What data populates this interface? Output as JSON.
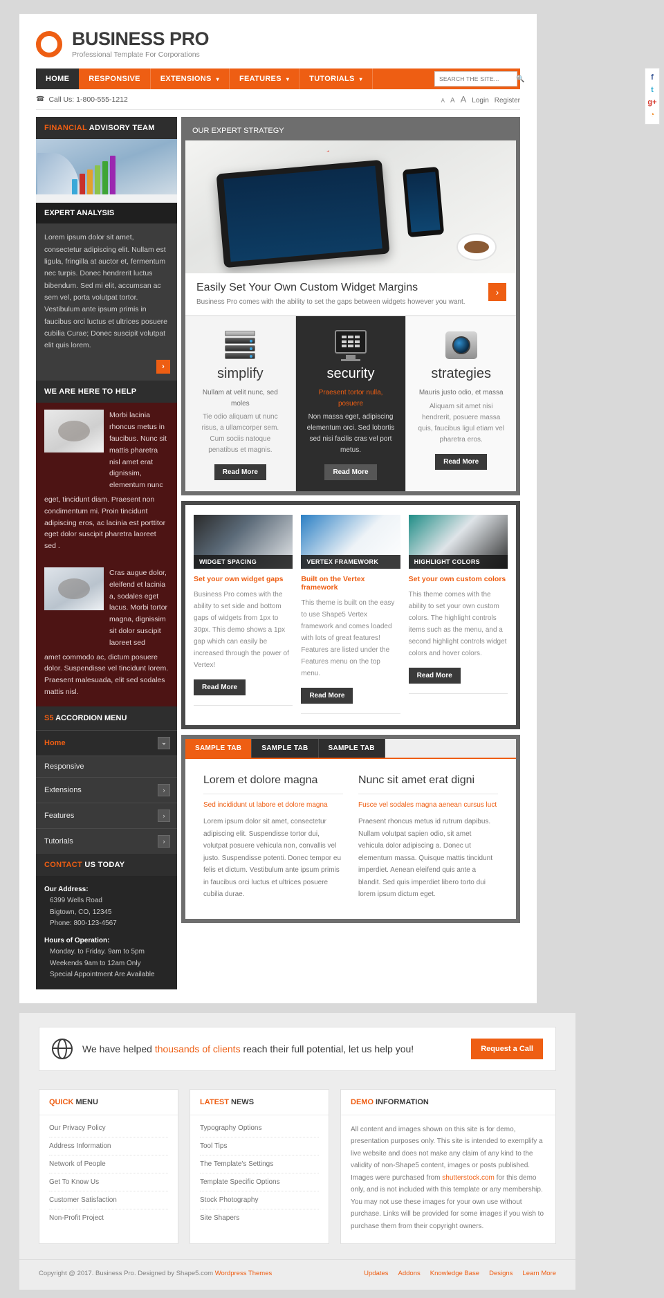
{
  "brand": {
    "name": "BUSINESS PRO",
    "tagline": "Professional Template For Corporations"
  },
  "nav": {
    "items": [
      {
        "label": "HOME",
        "caret": "",
        "active": true
      },
      {
        "label": "RESPONSIVE",
        "caret": "",
        "active": false
      },
      {
        "label": "EXTENSIONS",
        "caret": "▾",
        "active": false
      },
      {
        "label": "FEATURES",
        "caret": "▾",
        "active": false
      },
      {
        "label": "TUTORIALS",
        "caret": "▾",
        "active": false
      }
    ],
    "search_placeholder": "SEARCH THE SITE...",
    "search_value": "",
    "search_icon": "search-icon"
  },
  "utility": {
    "phone_icon": "phone-icon",
    "call_label": "Call Us: 1-800-555-1212",
    "font_small": "A",
    "font_medium": "A",
    "font_large": "A",
    "login": "Login",
    "register": "Register"
  },
  "social": {
    "facebook": "f",
    "twitter": "t",
    "googleplus": "g+",
    "rss": "◔"
  },
  "sidebar": {
    "financial": {
      "head_hl": "FINANCIAL",
      "head_rest": " ADVISORY TEAM",
      "subhead": "EXPERT ANALYSIS",
      "body": "Lorem ipsum dolor sit amet, consectetur adipiscing elit. Nullam est ligula, fringilla at auctor et, fermentum nec turpis. Donec hendrerit luctus bibendum. Sed mi elit, accumsan ac sem vel, porta volutpat tortor. Vestibulum ante ipsum primis in faucibus orci luctus et ultrices posuere cubilia Curae; Donec suscipit volutpat elit quis lorem.",
      "more_icon": "›"
    },
    "help": {
      "head": "WE ARE HERE TO HELP",
      "item1_text": "Morbi lacinia rhoncus metus in faucibus. Nunc sit mattis pharetra nisl amet erat dignissim, elementum nunc",
      "item1_tail": "eget, tincidunt diam. Praesent non condimentum mi. Proin tincidunt adipiscing eros, ac lacinia est porttitor eget dolor suscipit pharetra laoreet sed .",
      "item2_text": "Cras augue dolor, eleifend et lacinia a, sodales eget lacus. Morbi tortor magna, dignissim sit dolor suscipit laoreet sed",
      "item2_tail": "amet commodo ac, dictum posuere dolor. Suspendisse vel tincidunt lorem. Praesent malesuada, elit sed sodales mattis nisl."
    },
    "accordion": {
      "head_hl": "S5",
      "head_rest": " ACCORDION MENU",
      "items": [
        {
          "label": "Home",
          "active": true,
          "chevron": "⌄"
        },
        {
          "label": "Responsive",
          "active": false,
          "chevron": ""
        },
        {
          "label": "Extensions",
          "active": false,
          "chevron": "›"
        },
        {
          "label": "Features",
          "active": false,
          "chevron": "›"
        },
        {
          "label": "Tutorials",
          "active": false,
          "chevron": "›"
        }
      ]
    },
    "contact": {
      "head_hl": "CONTACT",
      "head_rest": " US TODAY",
      "address_label": "Our Address:",
      "address_line1": "6399 Wells Road",
      "address_line2": "Bigtown, CO, 12345",
      "address_line3": "Phone: 800-123-4567",
      "hours_label": "Hours of Operation:",
      "hours_line1": "Monday. to Friday. 9am to 5pm",
      "hours_line2": "Weekends 9am to 12am Only",
      "hours_line3": "Special Appointment Are Available"
    }
  },
  "main": {
    "strategy_head": "OUR EXPERT STRATEGY",
    "hero": {
      "title": "Easily Set Your Own Custom Widget Margins",
      "subtitle": "Business Pro comes with the ability to set the gaps between widgets however you want.",
      "next_icon": "›"
    },
    "features": [
      {
        "title": "simplify",
        "icon": "server-icon",
        "lead": "Nullam at velit nunc, sed moles",
        "desc": "Tie odio aliquam ut nunc risus, a ullamcorper sem. Cum sociis natoque penatibus et magnis.",
        "button": "Read More"
      },
      {
        "title": "security",
        "icon": "monitor-keypad-icon",
        "lead": "Praesent tortor nulla, posuere",
        "desc": "Non massa eget, adipiscing elementum orci. Sed lobortis sed nisi facilis cras vel port metus.",
        "button": "Read More"
      },
      {
        "title": "strategies",
        "icon": "camera-lens-icon",
        "lead": "Mauris justo odio, et massa",
        "desc": "Aliquam sit amet nisi hendrerit, posuere massa quis, faucibus ligul etiam vel pharetra eros.",
        "button": "Read More"
      }
    ],
    "cards": [
      {
        "image_label": "WIDGET SPACING",
        "title": "Set your own widget gaps",
        "body": "Business Pro comes with the ability to set side and bottom gaps of widgets from 1px to 30px. This demo shows a 1px gap which can easily be increased through the power of Vertex!",
        "button": "Read More"
      },
      {
        "image_label": "VERTEX FRAMEWORK",
        "title": "Built on the Vertex framework",
        "body": "This theme is built on the easy to use Shape5 Vertex framework and comes loaded with lots of great features! Features are listed under the Features menu on the top menu.",
        "button": "Read More"
      },
      {
        "image_label": "HIGHLIGHT COLORS",
        "title": "Set your own custom colors",
        "body": "This theme comes with the ability to set your own custom colors. The highlight controls items such as the menu, and a second highlight controls widget colors and hover colors.",
        "button": "Read More"
      }
    ],
    "tabs": {
      "items": [
        {
          "label": "SAMPLE TAB",
          "active": true
        },
        {
          "label": "SAMPLE TAB",
          "active": false
        },
        {
          "label": "SAMPLE TAB",
          "active": false
        }
      ],
      "columns": [
        {
          "title": "Lorem et dolore magna",
          "sub": "Sed incididunt ut labore et dolore magna",
          "body": "Lorem ipsum dolor sit amet, consectetur adipiscing elit. Suspendisse tortor dui, volutpat posuere vehicula non, convallis vel justo. Suspendisse potenti. Donec tempor eu felis et dictum. Vestibulum ante ipsum primis in faucibus orci luctus et ultrices posuere cubilia durae."
        },
        {
          "title": "Nunc sit amet erat digni",
          "sub": "Fusce vel sodales magna aenean cursus luct",
          "body": "Praesent rhoncus metus id rutrum dapibus. Nullam volutpat sapien odio, sit amet vehicula dolor adipiscing a. Donec ut elementum massa. Quisque mattis tincidunt imperdiet. Aenean eleifend quis ante a blandit. Sed quis imperdiet libero torto dui lorem ipsum dictum eget."
        }
      ]
    }
  },
  "cta": {
    "icon": "globe-icon",
    "text_before": "We have helped ",
    "text_highlight": "thousands of clients",
    "text_after": " reach their full potential, let us help you!",
    "button": "Request a Call"
  },
  "footer": {
    "quick": {
      "head_hl": "QUICK",
      "head_rest": " MENU",
      "items": [
        "Our Privacy Policy",
        "Address Information",
        "Network of People",
        "Get To Know Us",
        "Customer Satisfaction",
        "Non-Profit Project"
      ]
    },
    "latest": {
      "head_hl": "LATEST",
      "head_rest": " NEWS",
      "items": [
        "Typography Options",
        "Tool Tips",
        "The Template's Settings",
        "Template Specific Options",
        "Stock Photography",
        "Site Shapers"
      ]
    },
    "demo": {
      "head_hl": "DEMO",
      "head_rest": " INFORMATION",
      "text_before": "All content and images shown on this site is for demo, presentation purposes only. This site is intended to exemplify a live website and does not make any claim of any kind to the validity of non-Shape5 content, images or posts published. Images were purchased from ",
      "text_highlight": "shutterstock.com",
      "text_after": " for this demo only, and is not included with this template or any membership. You may not use these images for your own use without purchase. Links will be provided for some images if you wish to purchase them from their copyright owners."
    }
  },
  "copyright": {
    "text_before": "Copyright @ 2017. Business Pro. Designed by Shape5.com ",
    "link": "Wordpress Themes",
    "links": [
      "Updates",
      "Addons",
      "Knowledge Base",
      "Designs",
      "Learn More"
    ]
  },
  "colors": {
    "accent": "#ee5e13",
    "dark": "#2e2e2e",
    "maroon": "#4d1414"
  }
}
